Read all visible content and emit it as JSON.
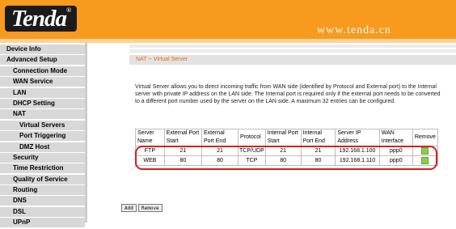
{
  "header": {
    "logo_text": "Tenda",
    "logo_mark": "®",
    "url": "www.tenda.cn"
  },
  "sidebar": {
    "items": [
      {
        "label": "Device Info",
        "level": 0
      },
      {
        "label": "Advanced Setup",
        "level": 0
      },
      {
        "label": "Connection Mode",
        "level": 1
      },
      {
        "label": "WAN Service",
        "level": 1
      },
      {
        "label": "LAN",
        "level": 1
      },
      {
        "label": "DHCP Setting",
        "level": 1
      },
      {
        "label": "NAT",
        "level": 1
      },
      {
        "label": "Virtual Servers",
        "level": 2
      },
      {
        "label": "Port Triggering",
        "level": 2
      },
      {
        "label": "DMZ Host",
        "level": 2
      },
      {
        "label": "Security",
        "level": 1
      },
      {
        "label": "Time Restriction",
        "level": 1
      },
      {
        "label": "Quality of Service",
        "level": 1
      },
      {
        "label": "Routing",
        "level": 1
      },
      {
        "label": "DNS",
        "level": 1
      },
      {
        "label": "DSL",
        "level": 1
      },
      {
        "label": "UPnP",
        "level": 1
      }
    ]
  },
  "main": {
    "title": "NAT -- Virtual Server",
    "description": "Virtual Server allows you to direct incoming traffic from WAN side (identified by Protocol and External port) to the Internal server with private IP address on the LAN side. The Internal port is required only if the external port needs to be converted to a different port number used by the server on the LAN side. A maximum 32 entries can be configured.",
    "table": {
      "headers": [
        "Server Name",
        "External Port Start",
        "External Port End",
        "Protocol",
        "Internal Port Start",
        "Internal Port End",
        "Server IP Address",
        "WAN Interface",
        "Remove"
      ],
      "rows": [
        [
          "FTP",
          "21",
          "21",
          "TCP/UDP",
          "21",
          "21",
          "192.168.1.100",
          "ppp0"
        ],
        [
          "WEB",
          "80",
          "80",
          "TCP",
          "80",
          "80",
          "192.168.1.110",
          "ppp0"
        ]
      ]
    },
    "buttons": {
      "add": "Add",
      "remove": "Remove"
    }
  },
  "colors": {
    "header": "#f79a1d",
    "title": "#e36d0a",
    "highlight": "#d71f1f",
    "checkbox": "#8ccc4e"
  }
}
